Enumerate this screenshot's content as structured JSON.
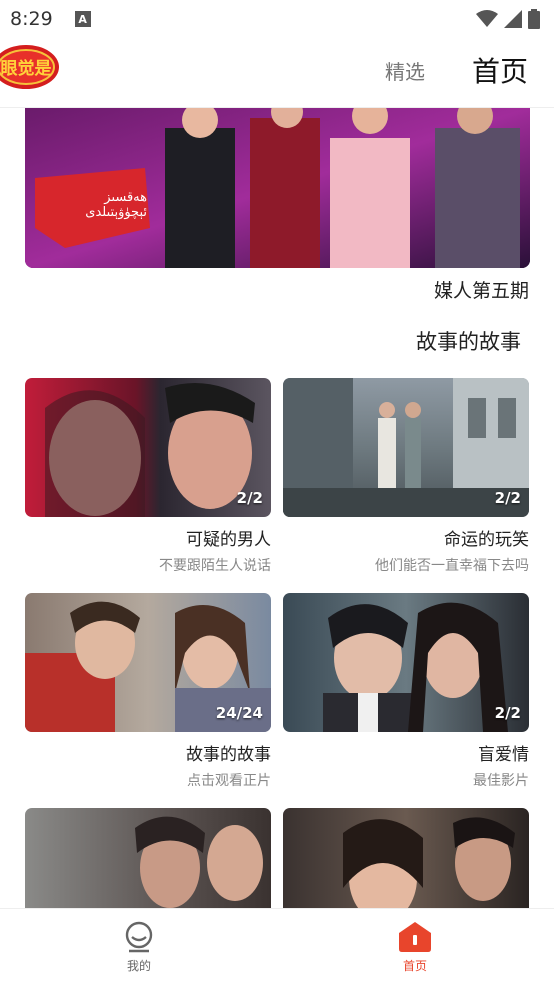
{
  "status_bar": {
    "time": "8:29",
    "notification_letter": "A"
  },
  "header": {
    "logo_text": "眼觉是",
    "tabs": [
      {
        "label": "精选",
        "active": false
      },
      {
        "label": "首页",
        "active": true
      }
    ]
  },
  "banner": {
    "overlay_text_line1": "ھەقسىز",
    "overlay_text_line2": "ئېچۈۋېتىلدى",
    "caption": "媒人第五期"
  },
  "section": {
    "title": "故事的故事"
  },
  "cards": [
    {
      "title": "可疑的男人",
      "subtitle": "不要跟陌生人说话",
      "episodes": "2/2"
    },
    {
      "title": "命运的玩笑",
      "subtitle": "他们能否一直幸福下去吗",
      "episodes": "2/2"
    },
    {
      "title": "故事的故事",
      "subtitle": "点击观看正片",
      "episodes": "24/24"
    },
    {
      "title": "盲爱情",
      "subtitle": "最佳影片",
      "episodes": "2/2"
    },
    {
      "title": "",
      "subtitle": "",
      "episodes": ""
    },
    {
      "title": "",
      "subtitle": "",
      "episodes": ""
    }
  ],
  "bottom_nav": {
    "items": [
      {
        "label": "我的",
        "icon": "profile-icon",
        "active": false
      },
      {
        "label": "首页",
        "icon": "home-icon",
        "active": true
      }
    ]
  },
  "colors": {
    "accent": "#e8452c",
    "text": "#222222",
    "muted": "#888888"
  }
}
